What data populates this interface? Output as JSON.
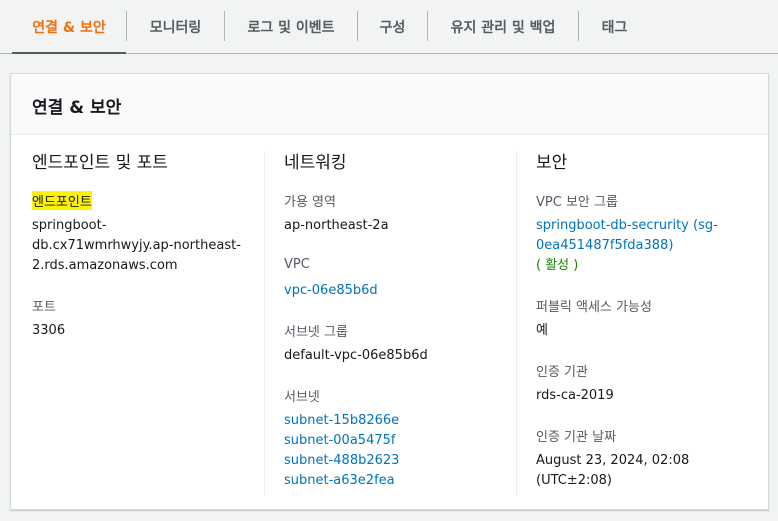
{
  "tabs": [
    {
      "label": "연결 & 보안",
      "active": true
    },
    {
      "label": "모니터링"
    },
    {
      "label": "로그 및 이벤트"
    },
    {
      "label": "구성"
    },
    {
      "label": "유지 관리 및 백업"
    },
    {
      "label": "태그"
    }
  ],
  "panel": {
    "title": "연결 & 보안",
    "endpoint_col": {
      "title": "엔드포인트 및 포트",
      "endpoint_label": "엔드포인트",
      "endpoint_lines": [
        "springboot-",
        "db.cx71wmrhwyjy.ap-northeast-",
        "2.rds.amazonaws.com"
      ],
      "port_label": "포트",
      "port_value": "3306"
    },
    "network_col": {
      "title": "네트워킹",
      "az_label": "가용 영역",
      "az_value": "ap-northeast-2a",
      "vpc_label": "VPC",
      "vpc_value": "vpc-06e85b6d",
      "subnet_group_label": "서브넷 그룹",
      "subnet_group_value": "default-vpc-06e85b6d",
      "subnets_label": "서브넷",
      "subnets": [
        "subnet-15b8266e",
        "subnet-00a5475f",
        "subnet-488b2623",
        "subnet-a63e2fea"
      ]
    },
    "security_col": {
      "title": "보안",
      "sg_label": "VPC 보안 그룹",
      "sg_link_lines": [
        "springboot-db-secrurity (sg-",
        "0ea451487f5fda388)"
      ],
      "sg_status": "( 활성 )",
      "public_label": "퍼블릭 액세스 가능성",
      "public_value": "예",
      "ca_label": "인증 기관",
      "ca_value": "rds-ca-2019",
      "ca_date_label": "인증 기관 날짜",
      "ca_date_lines": [
        "August 23, 2024, 02:08",
        "(UTC±2:08)"
      ]
    }
  },
  "colors": {
    "active_tab": "#ec7211",
    "link": "#0073bb",
    "status_ok": "#1d8102",
    "highlight": "#fff200"
  }
}
